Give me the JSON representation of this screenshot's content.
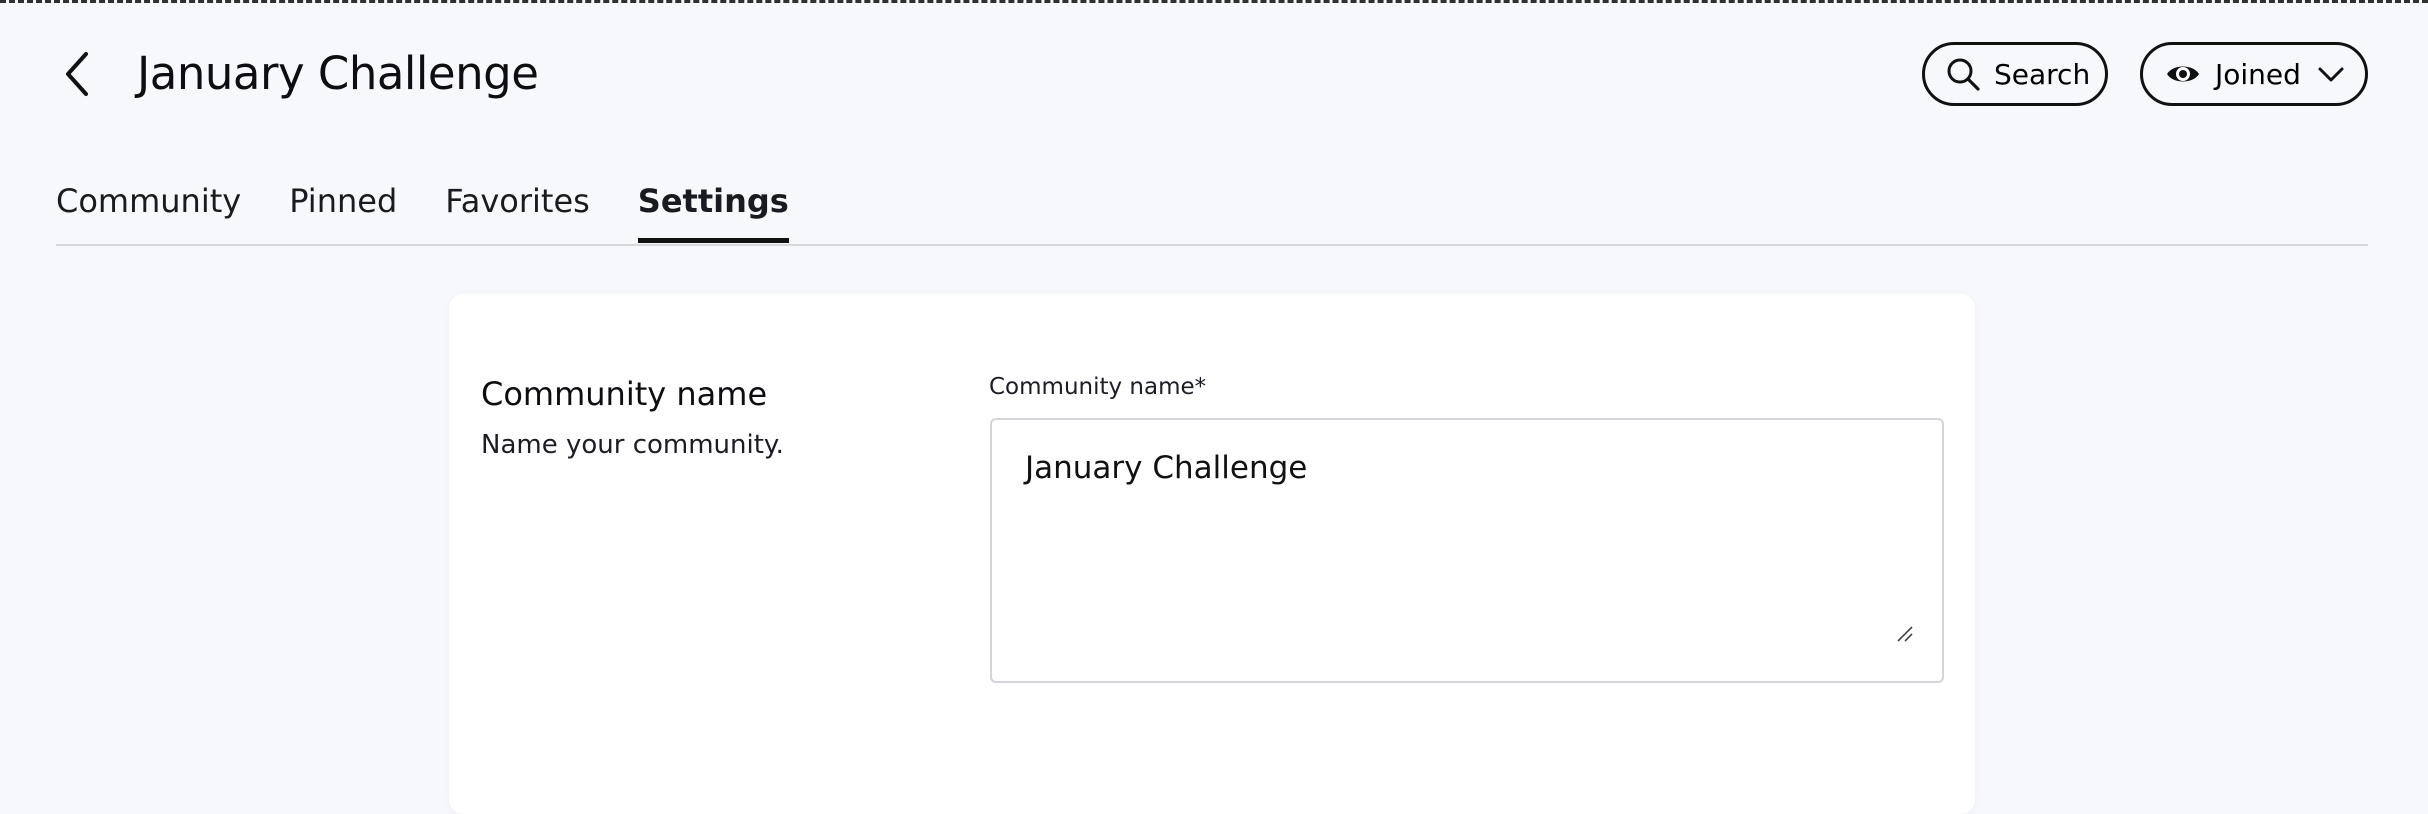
{
  "header": {
    "title": "January Challenge",
    "search_label": "Search",
    "membership_label": "Joined"
  },
  "tabs": [
    {
      "label": "Community",
      "active": false
    },
    {
      "label": "Pinned",
      "active": false
    },
    {
      "label": "Favorites",
      "active": false
    },
    {
      "label": "Settings",
      "active": true
    }
  ],
  "settings": {
    "section_title": "Community name",
    "section_description": "Name your community.",
    "field_label": "Community name*",
    "field_value": "January Challenge"
  },
  "icons": {
    "back": "chevron-left-icon",
    "search": "search-icon",
    "membership": "eye-icon",
    "dropdown": "chevron-down-icon"
  }
}
